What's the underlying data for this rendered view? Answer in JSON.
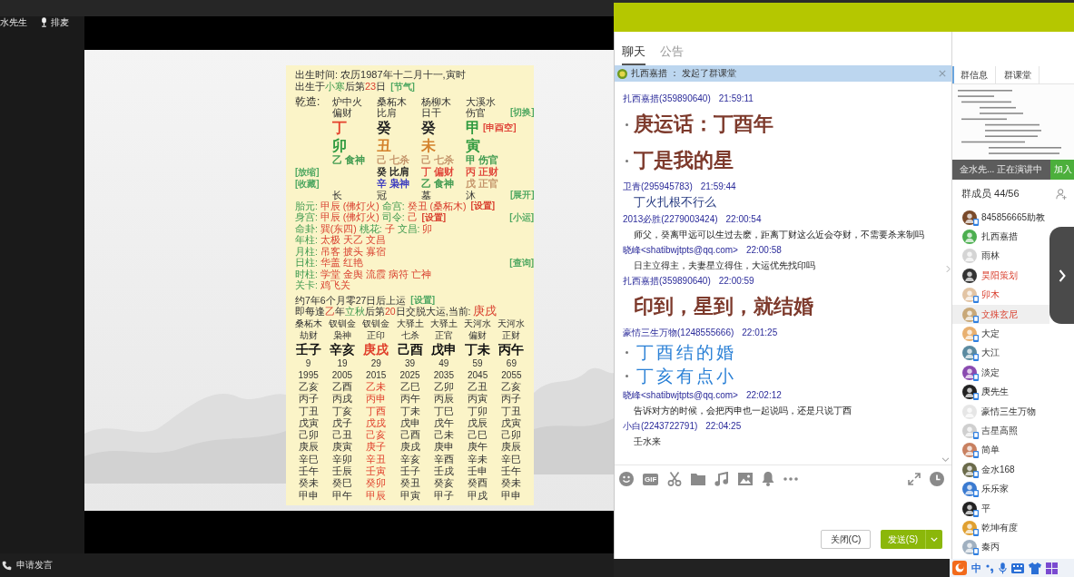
{
  "sidebar": {
    "speaker": "水先生",
    "queue_button": "排麦",
    "request_button": "申请发言"
  },
  "chart": {
    "header_lines": [
      {
        "segments": [
          {
            "text": "出生时间: 农历1987年十二月十一,寅时",
            "kind": "text"
          }
        ]
      },
      {
        "segments": [
          {
            "text": "出生于",
            "kind": "text"
          },
          {
            "text": "小寒",
            "kind": "label"
          },
          {
            "text": "后第",
            "kind": "text"
          },
          {
            "text": "23",
            "kind": "value"
          },
          {
            "text": "日",
            "kind": "text"
          }
        ],
        "link": {
          "text": "[节气]",
          "color": "#4fa862"
        }
      }
    ],
    "natal": {
      "title": "乾造:",
      "rows": [
        {
          "kind": "nayin",
          "cells": [
            "炉中火",
            "桑柘木",
            "杨柳木",
            "大溪水"
          ]
        },
        {
          "kind": "shishen",
          "cells": [
            "偏财",
            "比肩",
            "日干",
            "伤官"
          ],
          "right": {
            "text": "[切换]",
            "color": "#4fa862"
          }
        },
        {
          "kind": "stem",
          "cells": [
            {
              "text": "丁",
              "color": "#e5422c"
            },
            {
              "text": "癸",
              "color": "#222222"
            },
            {
              "text": "癸",
              "color": "#222222"
            },
            {
              "text": "甲",
              "color": "#2f9a3f",
              "tag": {
                "text": "[申酉空]",
                "color": "#e0463a"
              }
            }
          ]
        },
        {
          "kind": "branch",
          "cells": [
            {
              "text": "卯",
              "color": "#2f9a3f"
            },
            {
              "text": "丑",
              "color": "#d4822c"
            },
            {
              "text": "未",
              "color": "#d4822c"
            },
            {
              "text": "寅",
              "color": "#2f9a3f"
            }
          ]
        },
        {
          "kind": "hidden",
          "cells": [
            {
              "text": "乙 食神",
              "color": "#3f9a4f"
            },
            {
              "text": "己 七杀",
              "color": "#c4946a"
            },
            {
              "text": "己 七杀",
              "color": "#c4946a"
            },
            {
              "text": "甲 伤官",
              "color": "#3f9a4f"
            }
          ]
        },
        {
          "kind": "hidden",
          "left": {
            "text": "[放缩]",
            "color": "#4fa862"
          },
          "cells": [
            null,
            {
              "text": "癸 比肩",
              "color": "#222222"
            },
            {
              "text": "丁 偏财",
              "color": "#e0463a"
            },
            {
              "text": "丙 正财",
              "color": "#e0463a"
            }
          ]
        },
        {
          "kind": "hidden",
          "left": {
            "text": "[收藏]",
            "color": "#4fa862"
          },
          "cells": [
            null,
            {
              "text": "辛 枭神",
              "color": "#3a3ac0"
            },
            {
              "text": "乙 食神",
              "color": "#3f9a4f"
            },
            {
              "text": "戊 正官",
              "color": "#c4946a"
            }
          ]
        },
        {
          "kind": "stage",
          "cells": [
            "长",
            "冠",
            "墓",
            "沐"
          ],
          "right": {
            "text": "[展开]",
            "color": "#4fa862"
          }
        }
      ]
    },
    "info_lines": [
      {
        "segments": [
          {
            "text": "胎元: ",
            "kind": "label"
          },
          {
            "text": "甲辰 (佛灯火) ",
            "kind": "value"
          },
          {
            "text": "命宫: ",
            "kind": "label"
          },
          {
            "text": "癸丑 (桑柘木)",
            "kind": "value"
          }
        ],
        "link": {
          "text": "[设置]",
          "color": "#d9402f"
        }
      },
      {
        "segments": [
          {
            "text": "身宫: ",
            "kind": "label"
          },
          {
            "text": "甲辰 (佛灯火) ",
            "kind": "value"
          },
          {
            "text": "司令: ",
            "kind": "label"
          },
          {
            "text": "己",
            "kind": "value"
          }
        ],
        "link": {
          "text": "[设置]",
          "color": "#d9402f"
        },
        "right": {
          "text": "[小运]",
          "color": "#4fa862"
        }
      },
      {
        "segments": [
          {
            "text": "命卦: ",
            "kind": "label"
          },
          {
            "text": "巽(东四) ",
            "kind": "value"
          },
          {
            "text": "桃花: ",
            "kind": "label"
          },
          {
            "text": "子 ",
            "kind": "value"
          },
          {
            "text": "文昌: ",
            "kind": "label"
          },
          {
            "text": "卯",
            "kind": "value"
          }
        ]
      },
      {
        "segments": [
          {
            "text": "年柱: ",
            "kind": "label"
          },
          {
            "text": "太极 天乙 文昌",
            "kind": "value"
          }
        ]
      },
      {
        "segments": [
          {
            "text": "月柱: ",
            "kind": "label"
          },
          {
            "text": "吊客 披头 寡宿",
            "kind": "value"
          }
        ]
      },
      {
        "segments": [
          {
            "text": "日柱: ",
            "kind": "label"
          },
          {
            "text": "华盖 红艳",
            "kind": "value"
          }
        ],
        "right": {
          "text": "[查询]",
          "color": "#4fa862"
        }
      },
      {
        "segments": [
          {
            "text": "时柱: ",
            "kind": "label"
          },
          {
            "text": "学堂 金舆 流霞 病符 亡神",
            "kind": "value"
          }
        ]
      },
      {
        "segments": [
          {
            "text": "关卡: ",
            "kind": "label"
          },
          {
            "text": "鸡飞关",
            "kind": "value"
          }
        ]
      }
    ],
    "luck_lines": [
      {
        "segments": [
          {
            "text": "约7年6个月零27日后上运",
            "kind": "text"
          }
        ],
        "link": {
          "text": "[设置]",
          "color": "#4fa862"
        }
      },
      {
        "segments": [
          {
            "text": "即每逢",
            "kind": "text"
          },
          {
            "text": "乙",
            "kind": "value"
          },
          {
            "text": "年",
            "kind": "text"
          },
          {
            "text": "立秋",
            "kind": "label"
          },
          {
            "text": "后第",
            "kind": "text"
          },
          {
            "text": "20",
            "kind": "value"
          },
          {
            "text": "日交脱大运,当前: ",
            "kind": "text"
          },
          {
            "text": "庚戌",
            "kind": "big"
          }
        ]
      }
    ],
    "decades": [
      {
        "nayin": "桑柘木",
        "shishen": "劫财",
        "pillar": "壬子",
        "age": "9",
        "year": "1995",
        "years": [
          "乙亥",
          "丙子",
          "丁丑",
          "戊寅",
          "己卯",
          "庚辰",
          "辛巳",
          "壬午",
          "癸未",
          "甲申"
        ],
        "selected": false
      },
      {
        "nayin": "钗钏金",
        "shishen": "枭神",
        "pillar": "辛亥",
        "age": "19",
        "year": "2005",
        "years": [
          "乙酉",
          "丙戌",
          "丁亥",
          "戊子",
          "己丑",
          "庚寅",
          "辛卯",
          "壬辰",
          "癸巳",
          "甲午"
        ],
        "selected": false
      },
      {
        "nayin": "钗钏金",
        "shishen": "正印",
        "pillar": "庚戌",
        "age": "29",
        "year": "2015",
        "years": [
          "乙未",
          "丙申",
          "丁酉",
          "戊戌",
          "己亥",
          "庚子",
          "辛丑",
          "壬寅",
          "癸卯",
          "甲辰"
        ],
        "selected": true
      },
      {
        "nayin": "大驿土",
        "shishen": "七杀",
        "pillar": "己酉",
        "age": "39",
        "year": "2025",
        "years": [
          "乙巳",
          "丙午",
          "丁未",
          "戊申",
          "己酉",
          "庚戌",
          "辛亥",
          "壬子",
          "癸丑",
          "甲寅"
        ],
        "selected": false
      },
      {
        "nayin": "大驿土",
        "shishen": "正官",
        "pillar": "戊申",
        "age": "49",
        "year": "2035",
        "years": [
          "乙卯",
          "丙辰",
          "丁巳",
          "戊午",
          "己未",
          "庚申",
          "辛酉",
          "壬戌",
          "癸亥",
          "甲子"
        ],
        "selected": false
      },
      {
        "nayin": "天河水",
        "shishen": "偏财",
        "pillar": "丁未",
        "age": "59",
        "year": "2045",
        "years": [
          "乙丑",
          "丙寅",
          "丁卯",
          "戊辰",
          "己巳",
          "庚午",
          "辛未",
          "壬申",
          "癸酉",
          "甲戌"
        ],
        "selected": false
      },
      {
        "nayin": "天河水",
        "shishen": "正财",
        "pillar": "丙午",
        "age": "69",
        "year": "2055",
        "years": [
          "乙亥",
          "丙子",
          "丁丑",
          "戊寅",
          "己卯",
          "庚辰",
          "辛巳",
          "壬午",
          "癸未",
          "甲申"
        ],
        "selected": false
      }
    ]
  },
  "chat": {
    "tabs": [
      {
        "label": "聊天",
        "selected": true
      },
      {
        "label": "公告",
        "selected": false
      }
    ],
    "notice": "扎西嘉措 ： 发起了群课堂",
    "messages": [
      {
        "sender": "扎西嘉措",
        "open": "(",
        "contact": "359890640",
        "close": ")",
        "time": "21:59:11",
        "kind": "large",
        "bulleted": true,
        "lines": [
          "庚运话：丁酉年",
          "丁是我的星"
        ]
      },
      {
        "sender": "卫青",
        "open": "(",
        "contact": "295945783",
        "close": ")",
        "time": "21:59:44",
        "kind": "normal",
        "bulleted": false,
        "lines": [
          "丁火扎根不行么"
        ]
      },
      {
        "sender": "2013必胜",
        "open": "(",
        "contact": "2279003424",
        "close": ")",
        "time": "22:00:54",
        "kind": "small",
        "bulleted": false,
        "lines": [
          "师父，癸离甲远可以生过去麽，距离丁财这么近会夺财，不需要杀来制吗"
        ]
      },
      {
        "sender": "晓峰",
        "open": "<",
        "contact": "shatibwjtpts@qq.com",
        "close": ">",
        "time": "22:00:58",
        "kind": "small",
        "bulleted": false,
        "lines": [
          "日主立得主，夫妻星立得住，大运优先找印吗"
        ]
      },
      {
        "sender": "扎西嘉措",
        "open": "(",
        "contact": "359890640",
        "close": ")",
        "time": "22:00:59",
        "kind": "large",
        "bulleted": false,
        "lines": [
          "印到，星到，就结婚"
        ]
      },
      {
        "sender": "豪情三生万物",
        "open": "(",
        "contact": "1248555666",
        "close": ")",
        "time": "22:01:25",
        "kind": "blue",
        "bulleted": true,
        "lines": [
          "丁酉结的婚",
          "丁亥有点小"
        ]
      },
      {
        "sender": "晓峰",
        "open": "<",
        "contact": "shatibwjtpts@qq.com",
        "close": ">",
        "time": "22:02:12",
        "kind": "small",
        "bulleted": false,
        "lines": [
          "告诉对方的时候，会把丙申也一起说吗，还是只说丁酉"
        ]
      },
      {
        "sender": "小白",
        "open": "(",
        "contact": "2243722791",
        "close": ")",
        "time": "22:04:25",
        "kind": "small",
        "bulleted": false,
        "lines": [
          "壬水来"
        ]
      }
    ],
    "toolbar": [
      {
        "kind": "emoji"
      },
      {
        "kind": "gif",
        "label": "GIF"
      },
      {
        "kind": "scissors"
      },
      {
        "kind": "folder"
      },
      {
        "kind": "music"
      },
      {
        "kind": "image"
      },
      {
        "kind": "bell"
      },
      {
        "kind": "more"
      }
    ],
    "toolbar_right": [
      {
        "kind": "expand"
      },
      {
        "kind": "clock"
      }
    ],
    "close_button": "关闭(C)",
    "send_button": "发送(S)"
  },
  "group_panel": {
    "tabs": [
      {
        "label": "群信息",
        "selected": true
      },
      {
        "label": "群课堂",
        "selected": false
      }
    ],
    "live_status": "金水先... 正在演讲中",
    "join_button": "加入",
    "members_title": "群成员 44/56",
    "members": [
      {
        "name": "845856665助教",
        "color": "#7a4a2a",
        "admin": false,
        "mobile": true,
        "selected": false
      },
      {
        "name": "扎西嘉措",
        "color": "#4caf50",
        "admin": false,
        "mobile": false,
        "selected": false
      },
      {
        "name": "雨林",
        "color": "#d4d4d4",
        "admin": false,
        "mobile": false,
        "selected": false
      },
      {
        "name": "昊阳策划",
        "color": "#333333",
        "admin": true,
        "mobile": false,
        "selected": false
      },
      {
        "name": "卯木",
        "color": "#e2c4a4",
        "admin": true,
        "mobile": true,
        "selected": false
      },
      {
        "name": "文殊玄尼",
        "color": "#c8a878",
        "admin": true,
        "mobile": true,
        "selected": true
      },
      {
        "name": "大定",
        "color": "#e8b070",
        "admin": false,
        "mobile": true,
        "selected": false
      },
      {
        "name": "大江",
        "color": "#5a8aa0",
        "admin": false,
        "mobile": true,
        "selected": false
      },
      {
        "name": "淡定",
        "color": "#8a4ab0",
        "admin": false,
        "mobile": true,
        "selected": false
      },
      {
        "name": "庚先生",
        "color": "#222222",
        "admin": false,
        "mobile": true,
        "selected": false
      },
      {
        "name": "豪情三生万物",
        "color": "#e6e6e6",
        "admin": false,
        "mobile": false,
        "selected": false
      },
      {
        "name": "吉星高照",
        "color": "#cfcfcf",
        "admin": false,
        "mobile": true,
        "selected": false
      },
      {
        "name": "简单",
        "color": "#c88060",
        "admin": false,
        "mobile": true,
        "selected": false
      },
      {
        "name": "金水168",
        "color": "#6a6a4a",
        "admin": false,
        "mobile": true,
        "selected": false
      },
      {
        "name": "乐乐家",
        "color": "#3a7ad0",
        "admin": false,
        "mobile": true,
        "selected": false
      },
      {
        "name": "平",
        "color": "#222222",
        "admin": false,
        "mobile": true,
        "selected": false
      },
      {
        "name": "乾坤有度",
        "color": "#e0a030",
        "admin": false,
        "mobile": true,
        "selected": false
      },
      {
        "name": "秦丙",
        "color": "#a0b0c0",
        "admin": false,
        "mobile": true,
        "selected": false
      }
    ]
  },
  "taskbar": {
    "input_mode": "中"
  }
}
